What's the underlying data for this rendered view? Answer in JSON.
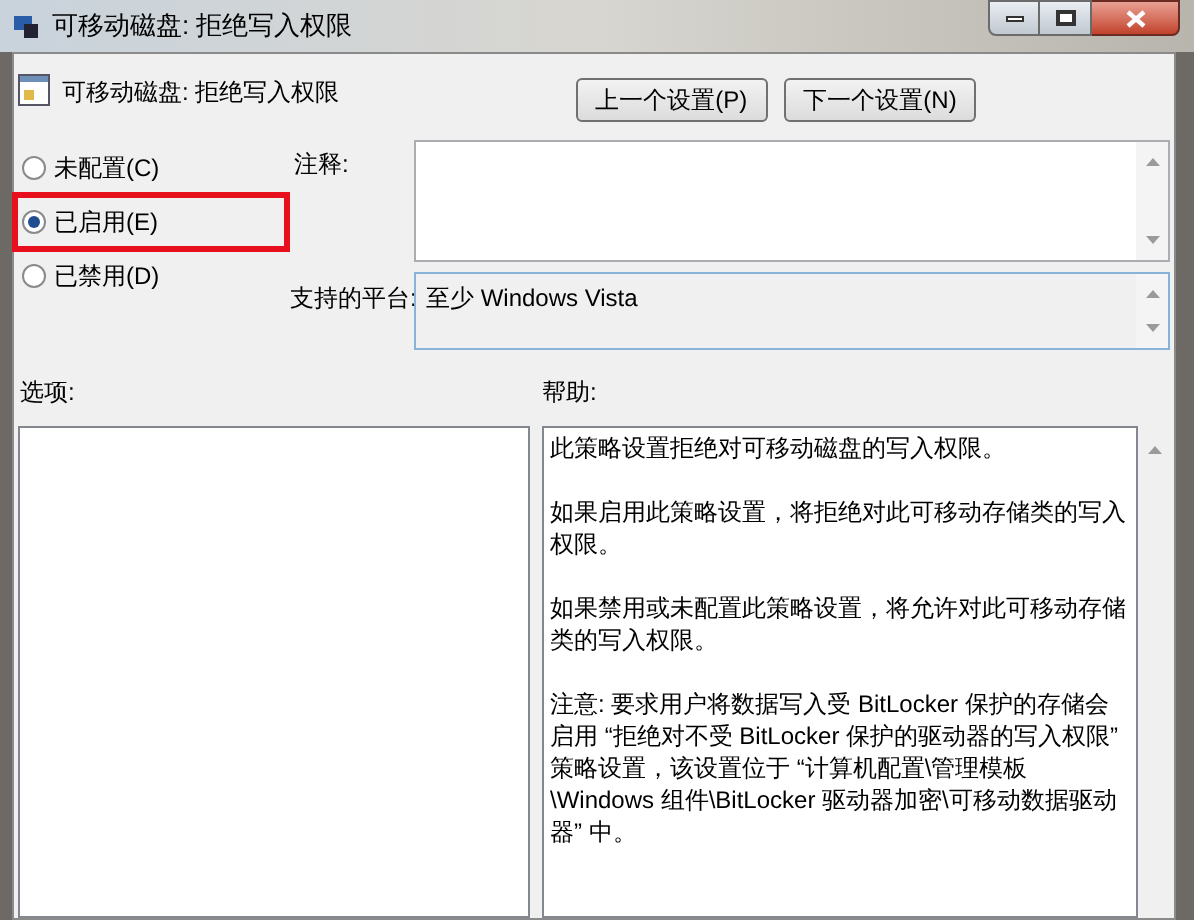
{
  "window": {
    "title": "可移动磁盘: 拒绝写入权限"
  },
  "header": {
    "title": "可移动磁盘: 拒绝写入权限",
    "buttons": [
      "上一个设置(P)",
      "下一个设置(N)"
    ]
  },
  "options": [
    {
      "label": "未配置(C)",
      "selected": false,
      "highlighted": false
    },
    {
      "label": "已启用(E)",
      "selected": true,
      "highlighted": true
    },
    {
      "label": "已禁用(D)",
      "selected": false,
      "highlighted": false
    }
  ],
  "comment": {
    "label": "注释:"
  },
  "platform": {
    "label": "支持的平台:",
    "value": "至少 Windows Vista"
  },
  "options_panel": {
    "label": "选项:"
  },
  "help": {
    "label": "帮助:",
    "paragraphs": [
      "此策略设置拒绝对可移动磁盘的写入权限。",
      "如果启用此策略设置，将拒绝对此可移动存储类的写入权限。",
      "如果禁用或未配置此策略设置，将允许对此可移动存储类的写入权限。",
      "注意: 要求用户将数据写入受 BitLocker 保护的存储会启用 “拒绝对不受 BitLocker 保护的驱动器的写入权限” 策略设置，该设置位于 “计算机配置\\管理模板\\Windows 组件\\BitLocker 驱动器加密\\可移动数据驱动器” 中。"
    ]
  }
}
